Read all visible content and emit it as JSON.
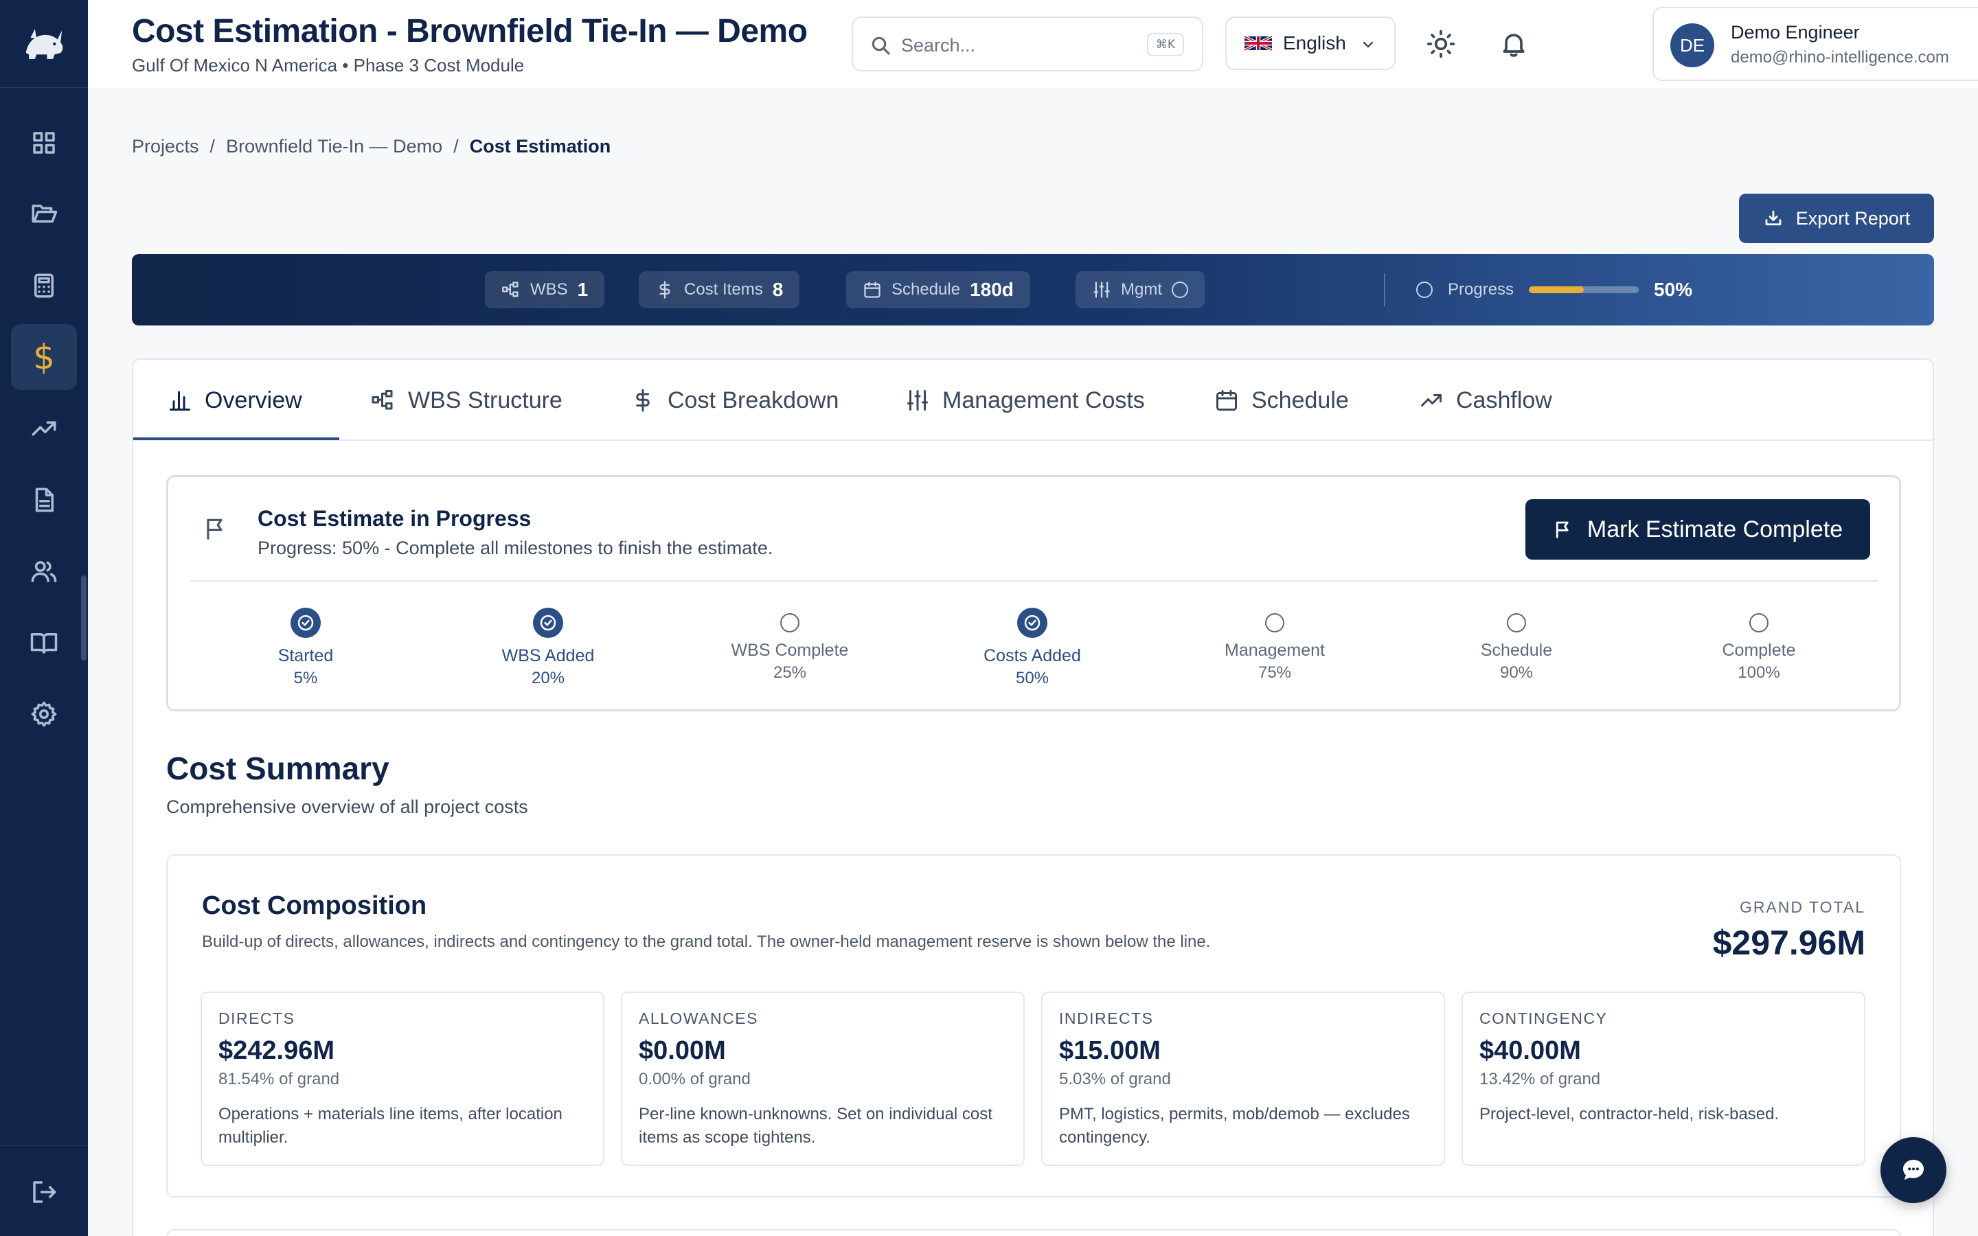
{
  "header": {
    "title": "Cost Estimation - Brownfield Tie-In — Demo",
    "subtitle": "Gulf Of Mexico N America • Phase 3 Cost Module",
    "search_placeholder": "Search...",
    "search_shortcut": "⌘K",
    "language": "English",
    "user_initials": "DE",
    "user_name": "Demo Engineer",
    "user_email": "demo@rhino-intelligence.com"
  },
  "breadcrumb": {
    "items": [
      "Projects",
      "Brownfield Tie-In — Demo",
      "Cost Estimation"
    ],
    "separator": "/"
  },
  "actions": {
    "export_label": "Export Report"
  },
  "stats": {
    "wbs_label": "WBS",
    "wbs_value": "1",
    "cost_items_label": "Cost Items",
    "cost_items_value": "8",
    "schedule_label": "Schedule",
    "schedule_value": "180d",
    "mgmt_label": "Mgmt",
    "progress_label": "Progress",
    "progress_value": "50%",
    "progress_fraction": 0.5
  },
  "tabs": [
    {
      "label": "Overview",
      "icon": "bar-chart-icon",
      "active": true
    },
    {
      "label": "WBS Structure",
      "icon": "hierarchy-icon"
    },
    {
      "label": "Cost Breakdown",
      "icon": "dollar-icon"
    },
    {
      "label": "Management Costs",
      "icon": "sliders-icon"
    },
    {
      "label": "Schedule",
      "icon": "calendar-icon"
    },
    {
      "label": "Cashflow",
      "icon": "trend-up-icon"
    }
  ],
  "progress_card": {
    "title": "Cost Estimate in Progress",
    "subtitle": "Progress: 50% - Complete all milestones to finish the estimate.",
    "button_label": "Mark Estimate Complete",
    "milestones": [
      {
        "label": "Started",
        "pct": "5%",
        "done": true
      },
      {
        "label": "WBS Added",
        "pct": "20%",
        "done": true
      },
      {
        "label": "WBS Complete",
        "pct": "25%",
        "done": false
      },
      {
        "label": "Costs Added",
        "pct": "50%",
        "done": true
      },
      {
        "label": "Management",
        "pct": "75%",
        "done": false
      },
      {
        "label": "Schedule",
        "pct": "90%",
        "done": false
      },
      {
        "label": "Complete",
        "pct": "100%",
        "done": false
      }
    ]
  },
  "summary": {
    "title": "Cost Summary",
    "subtitle": "Comprehensive overview of all project costs"
  },
  "composition": {
    "title": "Cost Composition",
    "subtitle": "Build-up of directs, allowances, indirects and contingency to the grand total. The owner-held management reserve is shown below the line.",
    "grand_total_label": "GRAND TOTAL",
    "grand_total_value": "$297.96M",
    "metrics": [
      {
        "label": "DIRECTS",
        "value": "$242.96M",
        "pct": "81.54% of grand",
        "desc": "Operations + materials line items, after location multiplier."
      },
      {
        "label": "ALLOWANCES",
        "value": "$0.00M",
        "pct": "0.00% of grand",
        "desc": "Per-line known-unknowns. Set on individual cost items as scope tightens."
      },
      {
        "label": "INDIRECTS",
        "value": "$15.00M",
        "pct": "5.03% of grand",
        "desc": "PMT, logistics, permits, mob/demob — excludes contingency."
      },
      {
        "label": "CONTINGENCY",
        "value": "$40.00M",
        "pct": "13.42% of grand",
        "desc": "Project-level, contractor-held, risk-based."
      }
    ]
  },
  "colors": {
    "sidebar": "#102549",
    "primary": "#2b4e86",
    "accent": "#e6b03a",
    "dark_button": "#0f2548"
  }
}
